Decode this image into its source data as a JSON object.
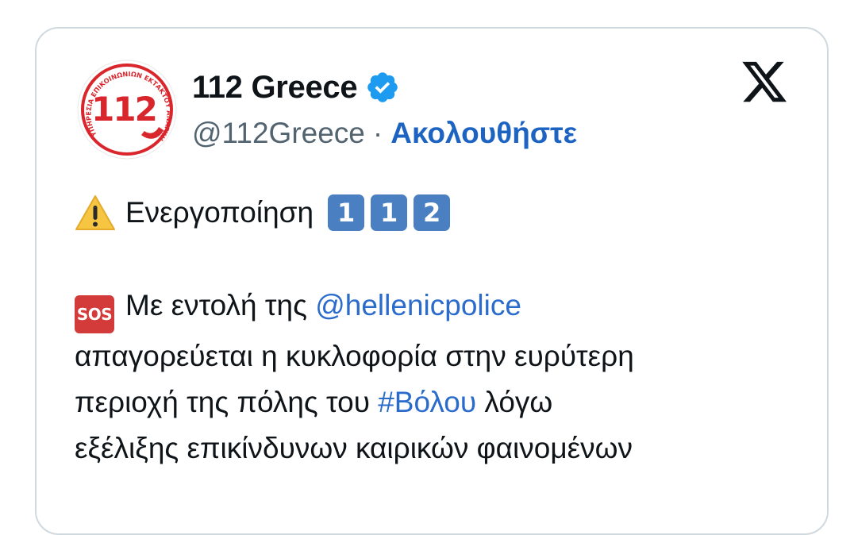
{
  "tweet": {
    "author": {
      "display_name": "112 Greece",
      "handle": "@112Greece",
      "verified_icon": "verified-badge-icon",
      "avatar": {
        "number": "112",
        "ring_text": "ΥΠΗΡΕΣΙΑ ΕΠΙΚΟΙΝΩΝΙΩΝ ΕΚΤΑΚΤΟΥ ΑΝΑΓΚΗΣ",
        "color": "#d9262c"
      }
    },
    "separator": "·",
    "follow_label": "Ακολουθήστε",
    "platform_icon": "x-logo-icon",
    "line1": {
      "icon": "warning-icon",
      "text": "Ενεργοποίηση",
      "keycaps": [
        "1",
        "1",
        "2"
      ]
    },
    "sos_icon_label": "SOS",
    "paragraph": {
      "seg1": "Με εντολή της ",
      "mention": "@hellenicpolice",
      "line2": "απαγορεύεται η κυκλοφορία στην ευρύτερη",
      "seg3": "περιοχή της πόλης του ",
      "hashtag": "#Βόλου",
      "seg4": " λόγω",
      "line4": "εξέλιξης επικίνδυνων καιρικών φαινομένων"
    }
  },
  "colors": {
    "link": "#2a6bcc",
    "follow": "#1d64c2",
    "secondary_text": "#536471",
    "border": "#cfd9de",
    "keycap": "#4a7fc1",
    "sos": "#d33a3a",
    "verified": "#1d9bf0"
  }
}
